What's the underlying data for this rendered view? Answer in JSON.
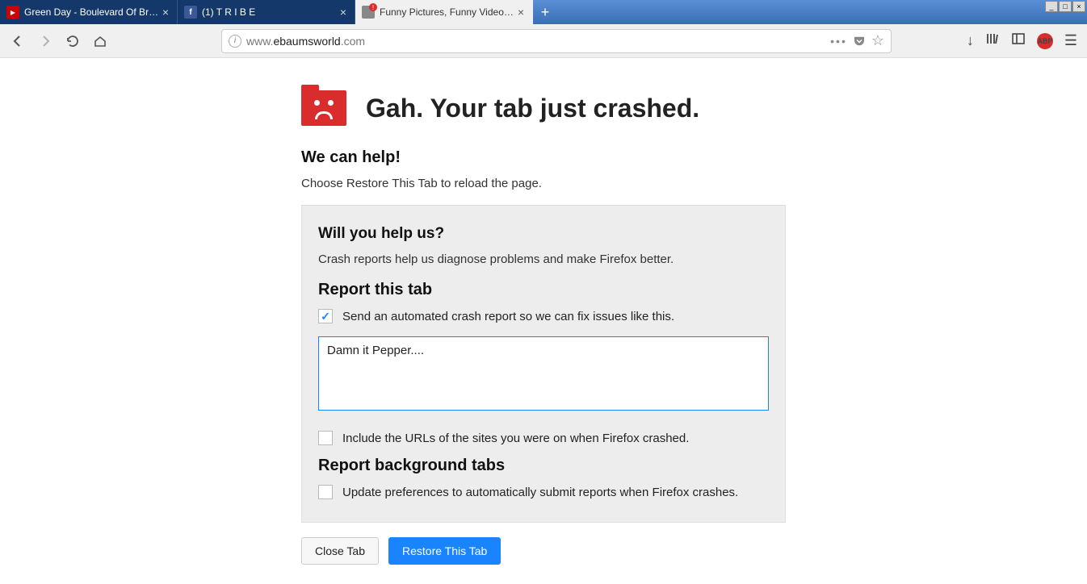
{
  "tabs": [
    {
      "title": "Green Day - Boulevard Of Broken",
      "active": false,
      "favicon": "youtube"
    },
    {
      "title": "(1) T R I B E",
      "active": false,
      "favicon": "facebook"
    },
    {
      "title": "Funny Pictures, Funny Videos | eB",
      "active": true,
      "favicon": "ebaums"
    }
  ],
  "url": {
    "prefix": "www.",
    "domain": "ebaumsworld",
    "suffix": ".com"
  },
  "crash": {
    "title": "Gah. Your tab just crashed.",
    "help_heading": "We can help!",
    "help_text": "Choose Restore This Tab to reload the page.",
    "panel_heading": "Will you help us?",
    "panel_text": "Crash reports help us diagnose problems and make Firefox better.",
    "report_heading": "Report this tab",
    "send_report_label": "Send an automated crash report so we can fix issues like this.",
    "send_report_checked": true,
    "comment_text": "Damn it Pepper....",
    "include_urls_label": "Include the URLs of the sites you were on when Firefox crashed.",
    "include_urls_checked": false,
    "bg_heading": "Report background tabs",
    "bg_label": "Update preferences to automatically submit reports when Firefox crashes.",
    "bg_checked": false,
    "close_button": "Close Tab",
    "restore_button": "Restore This Tab"
  },
  "abp_label": "ABP"
}
